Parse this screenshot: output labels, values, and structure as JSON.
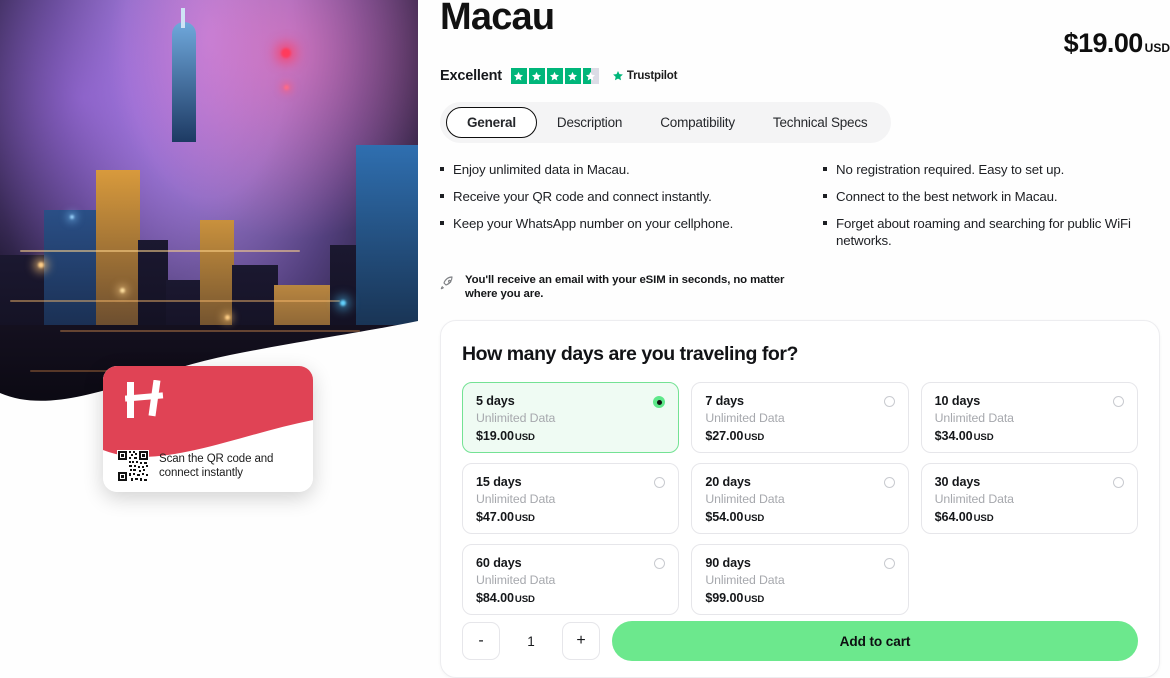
{
  "product": {
    "title": "Macau",
    "price": "$19.00",
    "currency": "USD"
  },
  "rating": {
    "word": "Excellent",
    "stars": 4.5,
    "provider": "Trustpilot"
  },
  "tabs": [
    {
      "label": "General",
      "active": true
    },
    {
      "label": "Description",
      "active": false
    },
    {
      "label": "Compatibility",
      "active": false
    },
    {
      "label": "Technical Specs",
      "active": false
    }
  ],
  "bullets_left": [
    "Enjoy unlimited data in Macau.",
    "Receive your QR code and connect instantly.",
    "Keep your WhatsApp number on your cellphone."
  ],
  "bullets_right": [
    "No registration required. Easy to set up.",
    "Connect to the best network in Macau.",
    "Forget about roaming and searching for public WiFi networks."
  ],
  "note": {
    "icon": "rocket-icon",
    "text": "You'll receive an email with your eSIM in seconds, no matter where you are."
  },
  "promo": {
    "logo": "holafly-h-logo",
    "qr_icon": "qr-code-icon",
    "text": "Scan the QR code and connect instantly"
  },
  "hero": {
    "alt": "macau-night-skyline-photo"
  },
  "selector": {
    "title": "How many days are you traveling for?",
    "data_label": "Unlimited Data",
    "currency": "USD",
    "plans": [
      {
        "days": "5 days",
        "data": "Unlimited Data",
        "price": "$19.00",
        "currency": "USD",
        "selected": true
      },
      {
        "days": "7 days",
        "data": "Unlimited Data",
        "price": "$27.00",
        "currency": "USD",
        "selected": false
      },
      {
        "days": "10 days",
        "data": "Unlimited Data",
        "price": "$34.00",
        "currency": "USD",
        "selected": false
      },
      {
        "days": "15 days",
        "data": "Unlimited Data",
        "price": "$47.00",
        "currency": "USD",
        "selected": false
      },
      {
        "days": "20 days",
        "data": "Unlimited Data",
        "price": "$54.00",
        "currency": "USD",
        "selected": false
      },
      {
        "days": "30 days",
        "data": "Unlimited Data",
        "price": "$64.00",
        "currency": "USD",
        "selected": false
      },
      {
        "days": "60 days",
        "data": "Unlimited Data",
        "price": "$84.00",
        "currency": "USD",
        "selected": false
      },
      {
        "days": "90 days",
        "data": "Unlimited Data",
        "price": "$99.00",
        "currency": "USD",
        "selected": false
      }
    ]
  },
  "cart": {
    "decrement_label": "-",
    "quantity": "1",
    "increment_label": "+",
    "add_label": "Add to cart"
  },
  "colors": {
    "accent_green": "#6ce88d",
    "selected_bg": "#effbf3",
    "selected_border": "#74e294",
    "trustpilot_green": "#00b67a",
    "promo_red": "#e04355"
  }
}
